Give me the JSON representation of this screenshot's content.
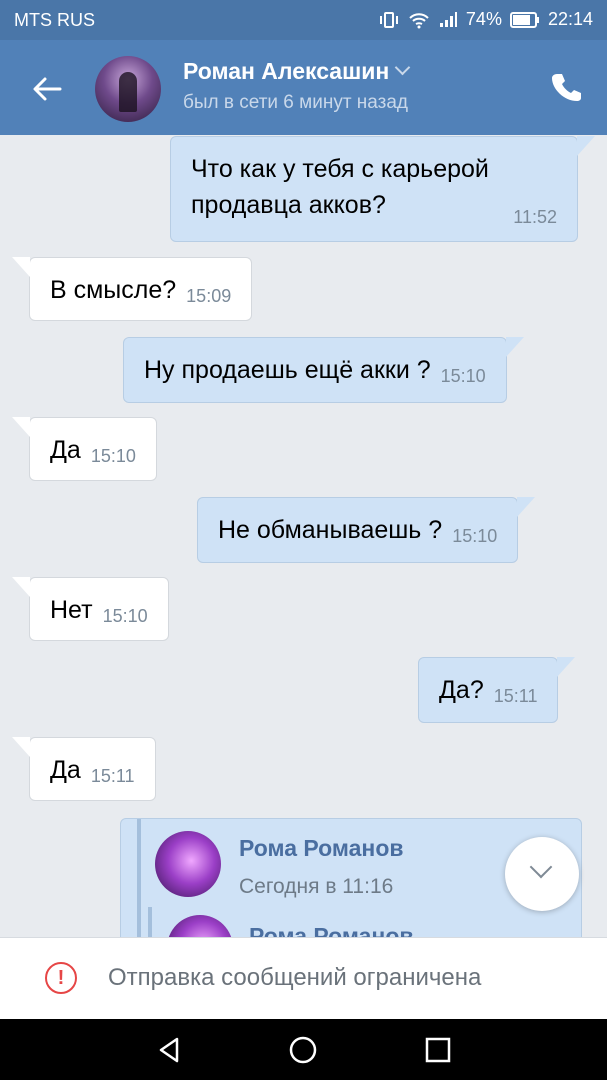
{
  "status": {
    "carrier": "MTS RUS",
    "battery": "74%",
    "time": "22:14",
    "icons": [
      "vibration-icon",
      "wifi-icon",
      "signal-icon",
      "battery-icon"
    ]
  },
  "header": {
    "name": "Роман Алексашин",
    "status": "был в сети 6 минут назад",
    "icons": [
      "back-arrow-icon",
      "chevron-down-icon",
      "phone-icon"
    ],
    "color": "#5181b8"
  },
  "messages": [
    {
      "dir": "out",
      "text_line1": "Что как у тебя с карьерой",
      "text_line2": "продавца акков?",
      "time": "11:52"
    },
    {
      "dir": "in",
      "text": "В смысле?",
      "time": "15:09"
    },
    {
      "dir": "out",
      "text": "Ну продаешь ещё акки ?",
      "time": "15:10"
    },
    {
      "dir": "in",
      "text": "Да",
      "time": "15:10"
    },
    {
      "dir": "out",
      "text": "Не обманываешь ?",
      "time": "15:10"
    },
    {
      "dir": "in",
      "text": "Нет",
      "time": "15:10"
    },
    {
      "dir": "out",
      "text": "Да?",
      "time": "15:11"
    },
    {
      "dir": "in",
      "text": "Да",
      "time": "15:11"
    }
  ],
  "forwarded": {
    "name": "Рома Романов",
    "date": "Сегодня в 11:16",
    "name2": "Рома Романов"
  },
  "footer": {
    "restricted_text": "Отправка сообщений ограничена",
    "warning_color": "#e64646"
  },
  "navigation": {
    "icons": [
      "back-triangle-icon",
      "home-circle-icon",
      "recents-square-icon"
    ]
  }
}
